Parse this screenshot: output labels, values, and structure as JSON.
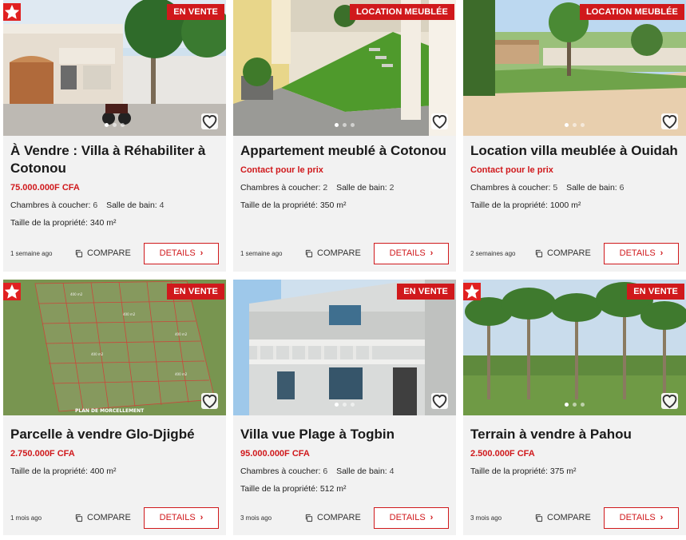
{
  "labels": {
    "compare": "COMPARE",
    "details": "DETAILS"
  },
  "listings": [
    {
      "status": "EN VENTE",
      "featured": true,
      "title": "À Vendre : Villa à Réhabiliter à Cotonou",
      "price": "75.000.000F CFA",
      "bedrooms_label": "Chambres à coucher:",
      "bedrooms": "6",
      "bathrooms_label": "Salle de bain:",
      "bathrooms": "4",
      "size_label": "Taille de la propriété:",
      "size": "340 m²",
      "date": "1 semaine ago"
    },
    {
      "status": "LOCATION MEUBLÉE",
      "featured": false,
      "title": "Appartement meublé à Cotonou",
      "price": "Contact pour le prix",
      "bedrooms_label": "Chambres à coucher:",
      "bedrooms": "2",
      "bathrooms_label": "Salle de bain:",
      "bathrooms": "2",
      "size_label": "Taille de la propriété:",
      "size": "350 m²",
      "date": "1 semaine ago"
    },
    {
      "status": "LOCATION MEUBLÉE",
      "featured": false,
      "title": "Location villa meublée à Ouidah",
      "price": "Contact pour le prix",
      "bedrooms_label": "Chambres à coucher:",
      "bedrooms": "5",
      "bathrooms_label": "Salle de bain:",
      "bathrooms": "6",
      "size_label": "Taille de la propriété:",
      "size": "1000 m²",
      "date": "2 semaines ago"
    },
    {
      "status": "EN VENTE",
      "featured": true,
      "title": "Parcelle à vendre Glo-Djigbé",
      "price": "2.750.000F CFA",
      "size_label": "Taille de la propriété:",
      "size": "400 m²",
      "date": "1 mois ago",
      "image_caption": "PLAN DE MORCELLEMENT",
      "plot_label": "400 m2"
    },
    {
      "status": "EN VENTE",
      "featured": false,
      "title": "Villa vue Plage à Togbin",
      "price": "95.000.000F CFA",
      "bedrooms_label": "Chambres à coucher:",
      "bedrooms": "6",
      "bathrooms_label": "Salle de bain:",
      "bathrooms": "4",
      "size_label": "Taille de la propriété:",
      "size": "512 m²",
      "date": "3 mois ago"
    },
    {
      "status": "EN VENTE",
      "featured": true,
      "title": "Terrain à vendre à Pahou",
      "price": "2.500.000F CFA",
      "size_label": "Taille de la propriété:",
      "size": "375 m²",
      "date": "3 mois ago"
    }
  ],
  "icons": {
    "featured": "star-icon",
    "favorite": "heart-icon",
    "compare": "copy-icon",
    "details": "chevron-right-icon"
  },
  "colors": {
    "accent": "#d0191c",
    "card_bg": "#f2f2f2"
  }
}
